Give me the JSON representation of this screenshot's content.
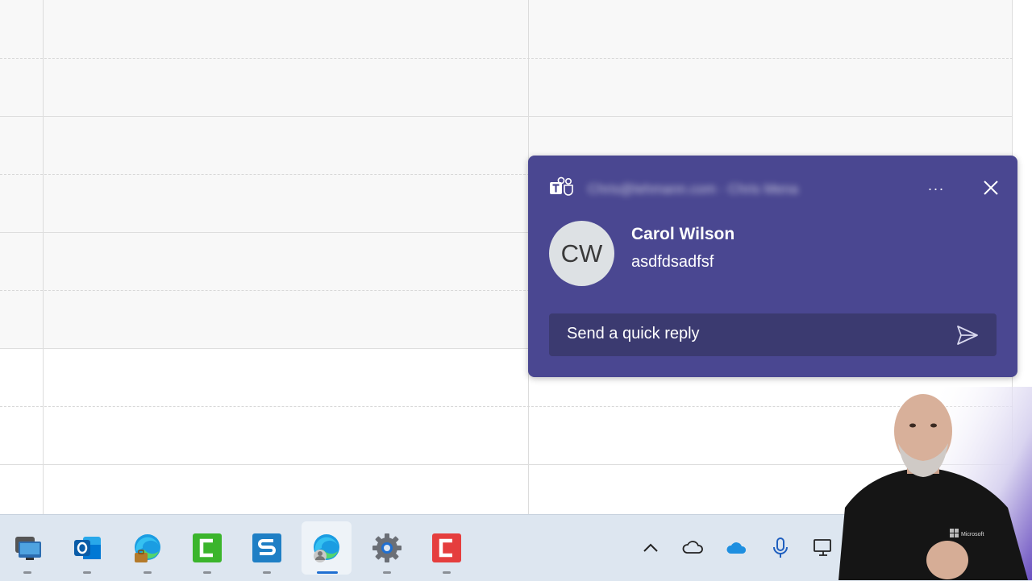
{
  "toast": {
    "sender_blurred": "Chris@lehmann.com · Chris Mena",
    "name": "Carol Wilson",
    "message": "asdfdsadfsf",
    "initials": "CW",
    "reply_placeholder": "Send a quick reply",
    "more_label": "···"
  },
  "colors": {
    "toast_bg": "#4a4791",
    "reply_bg": "#3b3a70",
    "avatar_bg": "#dde1e4",
    "taskbar_bg": "#dde6f0"
  },
  "taskbar": {
    "apps": [
      {
        "name": "remote-desktop"
      },
      {
        "name": "outlook"
      },
      {
        "name": "edge-work"
      },
      {
        "name": "camtasia"
      },
      {
        "name": "snagit"
      },
      {
        "name": "edge-profile"
      },
      {
        "name": "settings"
      },
      {
        "name": "camtasia-recorder"
      }
    ],
    "tray": [
      "chevron-up-icon",
      "onedrive-personal-icon",
      "onedrive-business-icon",
      "microphone-icon",
      "network-icon"
    ]
  }
}
